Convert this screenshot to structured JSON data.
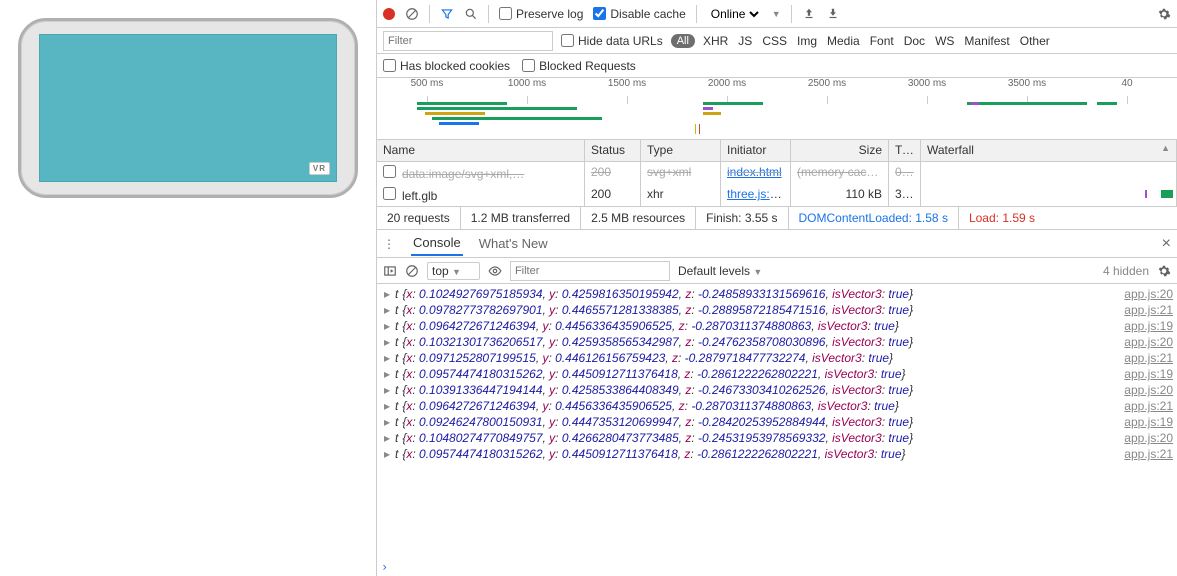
{
  "preview": {
    "vr_badge": "VR"
  },
  "toolbar": {
    "preserve_log_label": "Preserve log",
    "preserve_log_checked": false,
    "disable_cache_label": "Disable cache",
    "disable_cache_checked": true,
    "throttling": "Online"
  },
  "filter": {
    "placeholder": "Filter",
    "hide_data_urls_label": "Hide data URLs",
    "all_label": "All",
    "types": [
      "XHR",
      "JS",
      "CSS",
      "Img",
      "Media",
      "Font",
      "Doc",
      "WS",
      "Manifest",
      "Other"
    ]
  },
  "row2": {
    "blocked_cookies_label": "Has blocked cookies",
    "blocked_requests_label": "Blocked Requests"
  },
  "timeline": {
    "ticks": [
      "500 ms",
      "1000 ms",
      "1500 ms",
      "2000 ms",
      "2500 ms",
      "3000 ms",
      "3500 ms",
      "40"
    ]
  },
  "columns": {
    "name": "Name",
    "status": "Status",
    "type": "Type",
    "initiator": "Initiator",
    "size": "Size",
    "time": "Ti…",
    "waterfall": "Waterfall"
  },
  "rows": [
    {
      "name": "data:image/svg+xml,…",
      "status": "200",
      "type": "svg+xml",
      "initiator": "index.html",
      "size": "(memory cache)",
      "time": "0…",
      "dim": true
    },
    {
      "name": "left.glb",
      "status": "200",
      "type": "xhr",
      "initiator": "three.js:2…",
      "size": "110 kB",
      "time": "3…",
      "dim": false
    }
  ],
  "summary": {
    "requests": "20 requests",
    "transferred": "1.2 MB transferred",
    "resources": "2.5 MB resources",
    "finish": "Finish: 3.55 s",
    "domc": "DOMContentLoaded: 1.58 s",
    "load": "Load: 1.59 s"
  },
  "drawer": {
    "console_label": "Console",
    "whatsnew_label": "What's New"
  },
  "console_toolbar": {
    "context": "top",
    "filter_placeholder": "Filter",
    "levels": "Default levels",
    "hidden": "4 hidden"
  },
  "logs": [
    {
      "x": "0.10249276975185934",
      "y": "0.4259816350195942",
      "z": "-0.24858933131569616",
      "src": "app.js:20"
    },
    {
      "x": "0.09782773782697901",
      "y": "0.4465571281338385",
      "z": "-0.28895872185471516",
      "src": "app.js:21"
    },
    {
      "x": "0.0964272671246394",
      "y": "0.4456336435906525",
      "z": "-0.2870311374880863",
      "src": "app.js:19"
    },
    {
      "x": "0.10321301736206517",
      "y": "0.4259358565342987",
      "z": "-0.24762358708030896",
      "src": "app.js:20"
    },
    {
      "x": "0.0971252807199515",
      "y": "0.446126156759423",
      "z": "-0.2879718477732274",
      "src": "app.js:21"
    },
    {
      "x": "0.09574474180315262",
      "y": "0.4450912711376418",
      "z": "-0.2861222262802221",
      "src": "app.js:19"
    },
    {
      "x": "0.10391336447194144",
      "y": "0.4258533864408349",
      "z": "-0.24673303410262526",
      "src": "app.js:20"
    },
    {
      "x": "0.0964272671246394",
      "y": "0.4456336435906525",
      "z": "-0.2870311374880863",
      "src": "app.js:21"
    },
    {
      "x": "0.09246247800150931",
      "y": "0.4447353120699947",
      "z": "-0.28420253952884944",
      "src": "app.js:19"
    },
    {
      "x": "0.10480274770849757",
      "y": "0.4266280473773485",
      "z": "-0.24531953978569332",
      "src": "app.js:20"
    },
    {
      "x": "0.09574474180315262",
      "y": "0.4450912711376418",
      "z": "-0.2861222262802221",
      "src": "app.js:21"
    }
  ]
}
